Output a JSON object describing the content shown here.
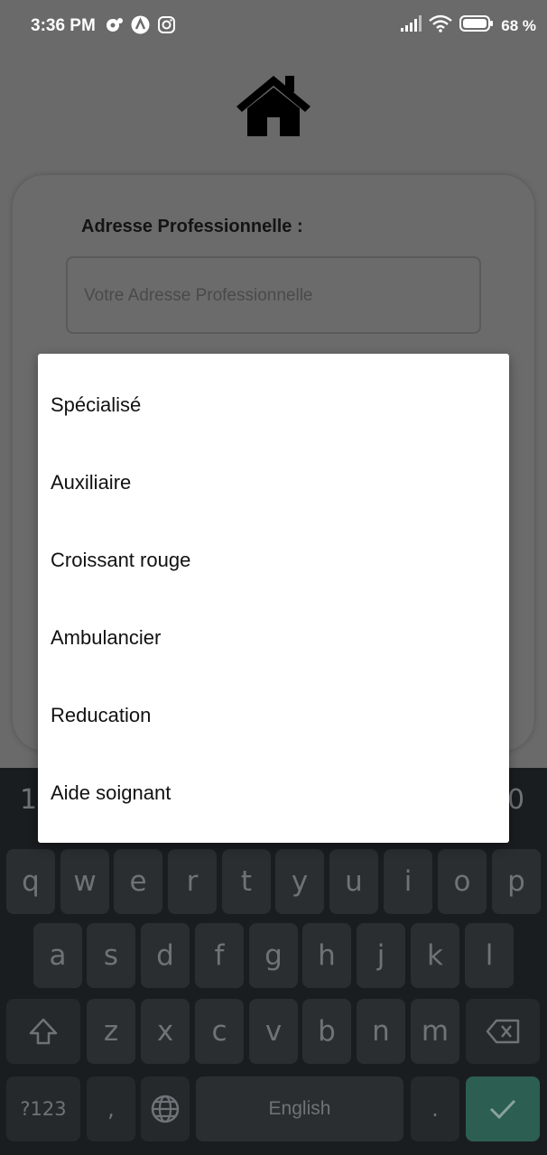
{
  "status_bar": {
    "time": "3:36 PM",
    "battery_percent": "68 %",
    "left_icons": [
      "notification-icon",
      "app-a-icon",
      "instagram-icon"
    ],
    "right_icons": [
      "signal-icon",
      "wifi-icon",
      "battery-icon"
    ]
  },
  "form": {
    "label": "Adresse Professionnelle :",
    "placeholder": "Votre Adresse Professionnelle"
  },
  "dropdown": {
    "options": [
      "Spécialisé",
      "Auxiliaire",
      "Croissant rouge",
      "Ambulancier",
      "Reducation",
      "Aide soignant"
    ]
  },
  "keyboard": {
    "number_hints": [
      "1",
      "0"
    ],
    "row1": [
      "q",
      "w",
      "e",
      "r",
      "t",
      "y",
      "u",
      "i",
      "o",
      "p"
    ],
    "row2": [
      "a",
      "s",
      "d",
      "f",
      "g",
      "h",
      "j",
      "k",
      "l"
    ],
    "row3": [
      "z",
      "x",
      "c",
      "v",
      "b",
      "n",
      "m"
    ],
    "symbols_label": "?123",
    "comma_label": ",",
    "space_label": "English",
    "period_label": "."
  },
  "colors": {
    "overlay_background": "#6a6a6a",
    "keyboard_background": "#1a1d20",
    "enter_key": "#2c5e52"
  }
}
